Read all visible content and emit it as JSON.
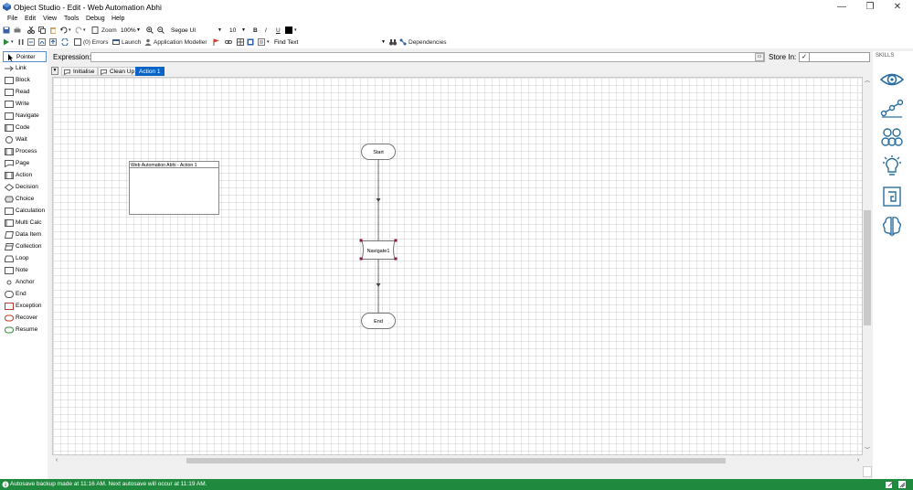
{
  "window": {
    "title": "Object Studio - Edit - Web Automation Abhi",
    "minimize": "—",
    "maximize": "❐",
    "close": "✕"
  },
  "menu": [
    "File",
    "Edit",
    "View",
    "Tools",
    "Debug",
    "Help"
  ],
  "toolbar1": {
    "zoom_label": "Zoom",
    "zoom_value": "100%",
    "font_family": "Segoe UI",
    "font_size": "10",
    "bold": "B",
    "italic": "I",
    "underline": "U"
  },
  "toolbar2": {
    "errors": "(0) Errors",
    "launch": "Launch",
    "app_modeller": "Application Modeller",
    "find_text": "Find Text",
    "dependencies": "Dependencies"
  },
  "toolbox": [
    "Pointer",
    "Link",
    "Block",
    "Read",
    "Write",
    "Navigate",
    "Code",
    "Wait",
    "Process",
    "Page",
    "Action",
    "Decision",
    "Choice",
    "Calculation",
    "Multi Calc",
    "Data Item",
    "Collection",
    "Loop",
    "Note",
    "Anchor",
    "End",
    "Exception",
    "Recover",
    "Resume"
  ],
  "expression": {
    "label": "Expression:",
    "value": "",
    "store_in_label": "Store In:",
    "store_in_value": ""
  },
  "tabs": [
    "Initialise",
    "Clean Up",
    "Action 1"
  ],
  "diagram": {
    "note_title": "Web Automation Abhi - Action 1",
    "start": "Start",
    "navigate": "Navigate1",
    "end": "End"
  },
  "skills": {
    "label": "SKILLS"
  },
  "status": {
    "message": "Autosave backup made at 11:16 AM. Next autosave will occur at 11:19 AM."
  },
  "colors": {
    "status_bg": "#1f8a3e",
    "tab_active": "#0a64c8",
    "skill_icon": "#2a6fa0"
  }
}
